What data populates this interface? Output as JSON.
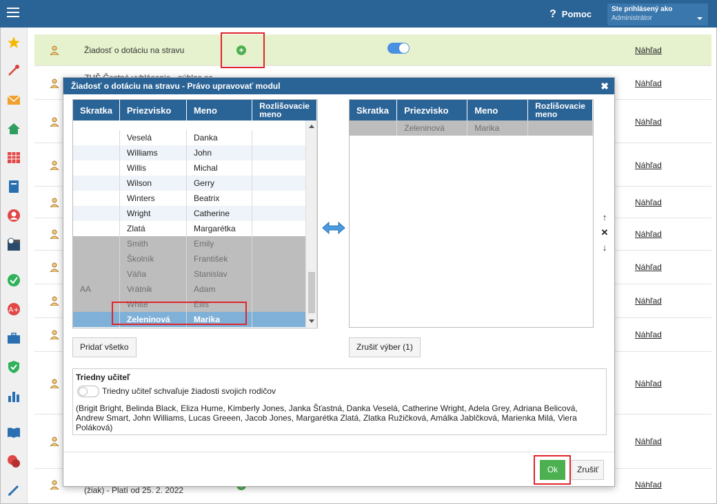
{
  "header": {
    "help_label": "Pomoc",
    "user_label": "Ste prihlásený ako",
    "user_name": "Administrátor"
  },
  "rows": [
    {
      "text": "Žiadosť o dotáciu na stravu",
      "link": "Náhľad"
    },
    {
      "text": "ZHŠ Čestné vyhlásenie - súhlas so",
      "link": "Náhľad"
    },
    {
      "text": "",
      "link": "Náhľad"
    },
    {
      "text": "",
      "link": "Náhľad"
    },
    {
      "text": "",
      "link": "Náhľad"
    },
    {
      "text": "",
      "link": "Náhľad"
    },
    {
      "text": "",
      "link": "Náhľad"
    },
    {
      "text": "",
      "link": "Náhľad"
    },
    {
      "text": "",
      "link": "Náhľad"
    },
    {
      "text": "",
      "link": "Náhľad"
    },
    {
      "text": "",
      "link": "Náhľad"
    },
    {
      "text": "",
      "link": "Náhľad"
    },
    {
      "text": "(žiak) - Platí od 25. 2. 2022",
      "link": "Náhľad"
    }
  ],
  "modal": {
    "title": "Žiadosť o dotáciu na stravu - Právo upravovať modul",
    "columns": [
      "Skratka",
      "Priezvisko",
      "Meno",
      "Rozlišovacie meno"
    ],
    "left_rows": [
      {
        "skratka": "",
        "priezvisko": "Veselá",
        "meno": "Danka"
      },
      {
        "skratka": "",
        "priezvisko": "Williams",
        "meno": "John"
      },
      {
        "skratka": "",
        "priezvisko": "Willis",
        "meno": "Michal"
      },
      {
        "skratka": "",
        "priezvisko": "Wilson",
        "meno": "Gerry"
      },
      {
        "skratka": "",
        "priezvisko": "Winters",
        "meno": "Beatrix"
      },
      {
        "skratka": "",
        "priezvisko": "Wright",
        "meno": "Catherine"
      },
      {
        "skratka": "",
        "priezvisko": "Zlatá",
        "meno": "Margarétka"
      },
      {
        "skratka": "",
        "priezvisko": "Smith",
        "meno": "Emily"
      },
      {
        "skratka": "",
        "priezvisko": "Školník",
        "meno": "František"
      },
      {
        "skratka": "",
        "priezvisko": "Váňa",
        "meno": "Stanislav"
      },
      {
        "skratka": "AA",
        "priezvisko": "Vrátnik",
        "meno": "Adam"
      },
      {
        "skratka": "",
        "priezvisko": "White",
        "meno": "Ellis"
      },
      {
        "skratka": "",
        "priezvisko": "Zeleninová",
        "meno": "Marika"
      }
    ],
    "right_rows": [
      {
        "skratka": "",
        "priezvisko": "Zeleninová",
        "meno": "Marika"
      }
    ],
    "add_all_label": "Pridať všetko",
    "cancel_selection_label": "Zrušiť výber (1)",
    "section_title": "Triedny učiteľ",
    "toggle_label": "Triedny učiteľ schvaľuje žiadosti svojich rodičov",
    "names_text": "(Brigit Bright, Belinda Black, Eliza Hume, Kimberly Jones, Janka Šťastná, Danka Veselá, Catherine Wright, Adela Grey, Adriana Belicová, Andrew Smart, John Williams, Lucas Greeen, Jacob Jones, Margarétka Zlatá, Zlatka Ružičková, Amálka Jablčková, Marienka Milá, Viera Poláková)",
    "ok_label": "Ok",
    "cancel_label": "Zrušiť"
  },
  "colors": {
    "header": "#2a6396",
    "highlight_row": "#e6f2cd",
    "selected_row": "#7eb0d8",
    "ok_button": "#4caf50",
    "red_annotation": "#e0232a"
  }
}
